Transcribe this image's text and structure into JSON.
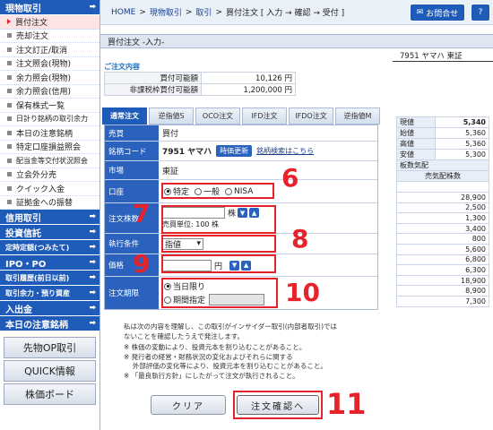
{
  "sidebar": {
    "sections": [
      {
        "title": "現物取引",
        "items": [
          "買付注文",
          "売却注文",
          "注文訂正/取消",
          "注文照会(現物)",
          "余力照会(現物)",
          "余力照会(信用)",
          "保有株式一覧",
          "日計り銘柄の取引余力",
          "本日の注意銘柄",
          "特定口座損益照会",
          "配当金等交付状況照会",
          "立会外分売",
          "クイック入金",
          "証拠金への振替"
        ]
      },
      {
        "title": "信用取引",
        "items": []
      },
      {
        "title": "投資信託",
        "items": []
      },
      {
        "title": "定時定額(つみたて)",
        "items": []
      },
      {
        "title": "IPO・PO",
        "items": []
      },
      {
        "title": "取引履歴(前日以前)",
        "items": []
      },
      {
        "title": "取引余力・預り資産",
        "items": []
      },
      {
        "title": "入出金",
        "items": []
      },
      {
        "title": "本日の注意銘柄",
        "items": []
      }
    ],
    "buttons": [
      "先物OP取引",
      "QUICK情報",
      "株価ボード"
    ]
  },
  "header": {
    "breadcrumb": [
      "HOME",
      "現物取引",
      "取引",
      "買付注文 [ 入力 → 確認 → 受付 ]"
    ],
    "contact": "お問合せ",
    "help": "?"
  },
  "page_title": "買付注文 -入力-",
  "content_title": "ご注文内容",
  "summary": [
    {
      "label": "買付可能額",
      "value": "10,126 円"
    },
    {
      "label": "非課税枠買付可能額",
      "value": "1,200,000 円"
    }
  ],
  "tabs": [
    "通常注文",
    "逆指値S",
    "OCO注文",
    "IFD注文",
    "IFDO注文",
    "逆指値M"
  ],
  "form": {
    "trade_label": "売買",
    "trade_value": "買付",
    "code_label": "銘柄コード",
    "code_value": "7951 ヤマハ",
    "refresh": "時価更新",
    "search_link": "銘柄検索はこちら",
    "market_label": "市場",
    "market_value": "東証",
    "account_label": "口座",
    "account_options": [
      "特定",
      "一般",
      "NISA"
    ],
    "qty_label": "注文株数",
    "qty_unit": "株",
    "qty_note": "売買単位: 100 株",
    "exec_label": "執行条件",
    "exec_value": "指値",
    "price_label": "価格",
    "price_unit": "円",
    "term_label": "注文期限",
    "term_options": [
      "当日限り",
      "期間指定"
    ]
  },
  "annotations": [
    "6",
    "7",
    "8",
    "9",
    "10",
    "11"
  ],
  "disclaimer": [
    "私は次の内容を理解し、この取引がインサイダー取引(内部者取引)では",
    "ないことを確認したうえで発注します。",
    "※ 株価の変動により、投資元本を割り込むことがあること。",
    "※ 発行者の経営・財務状況の変化およびそれらに関する",
    "　 外部評価の変化等により、投資元本を割り込むことがあること。",
    "※ 「最良執行方針」にしたがって注文が執行されること。"
  ],
  "buttons": {
    "clear": "クリア",
    "confirm": "注文確認へ"
  },
  "quote": {
    "header": "7951 ヤマハ 東証",
    "rows": [
      {
        "label": "現値",
        "value": "5,340"
      },
      {
        "label": "始値",
        "value": "5,360"
      },
      {
        "label": "高値",
        "value": "5,360"
      },
      {
        "label": "安値",
        "value": "5,300"
      }
    ],
    "board_label": "板数気配",
    "sell_col": "売気配株数",
    "sell": [
      "28,900",
      "2,500",
      "1,300",
      "3,400",
      "800",
      "5,600",
      "6,800",
      "6,300",
      "18,900",
      "8,900",
      "7,300"
    ]
  }
}
